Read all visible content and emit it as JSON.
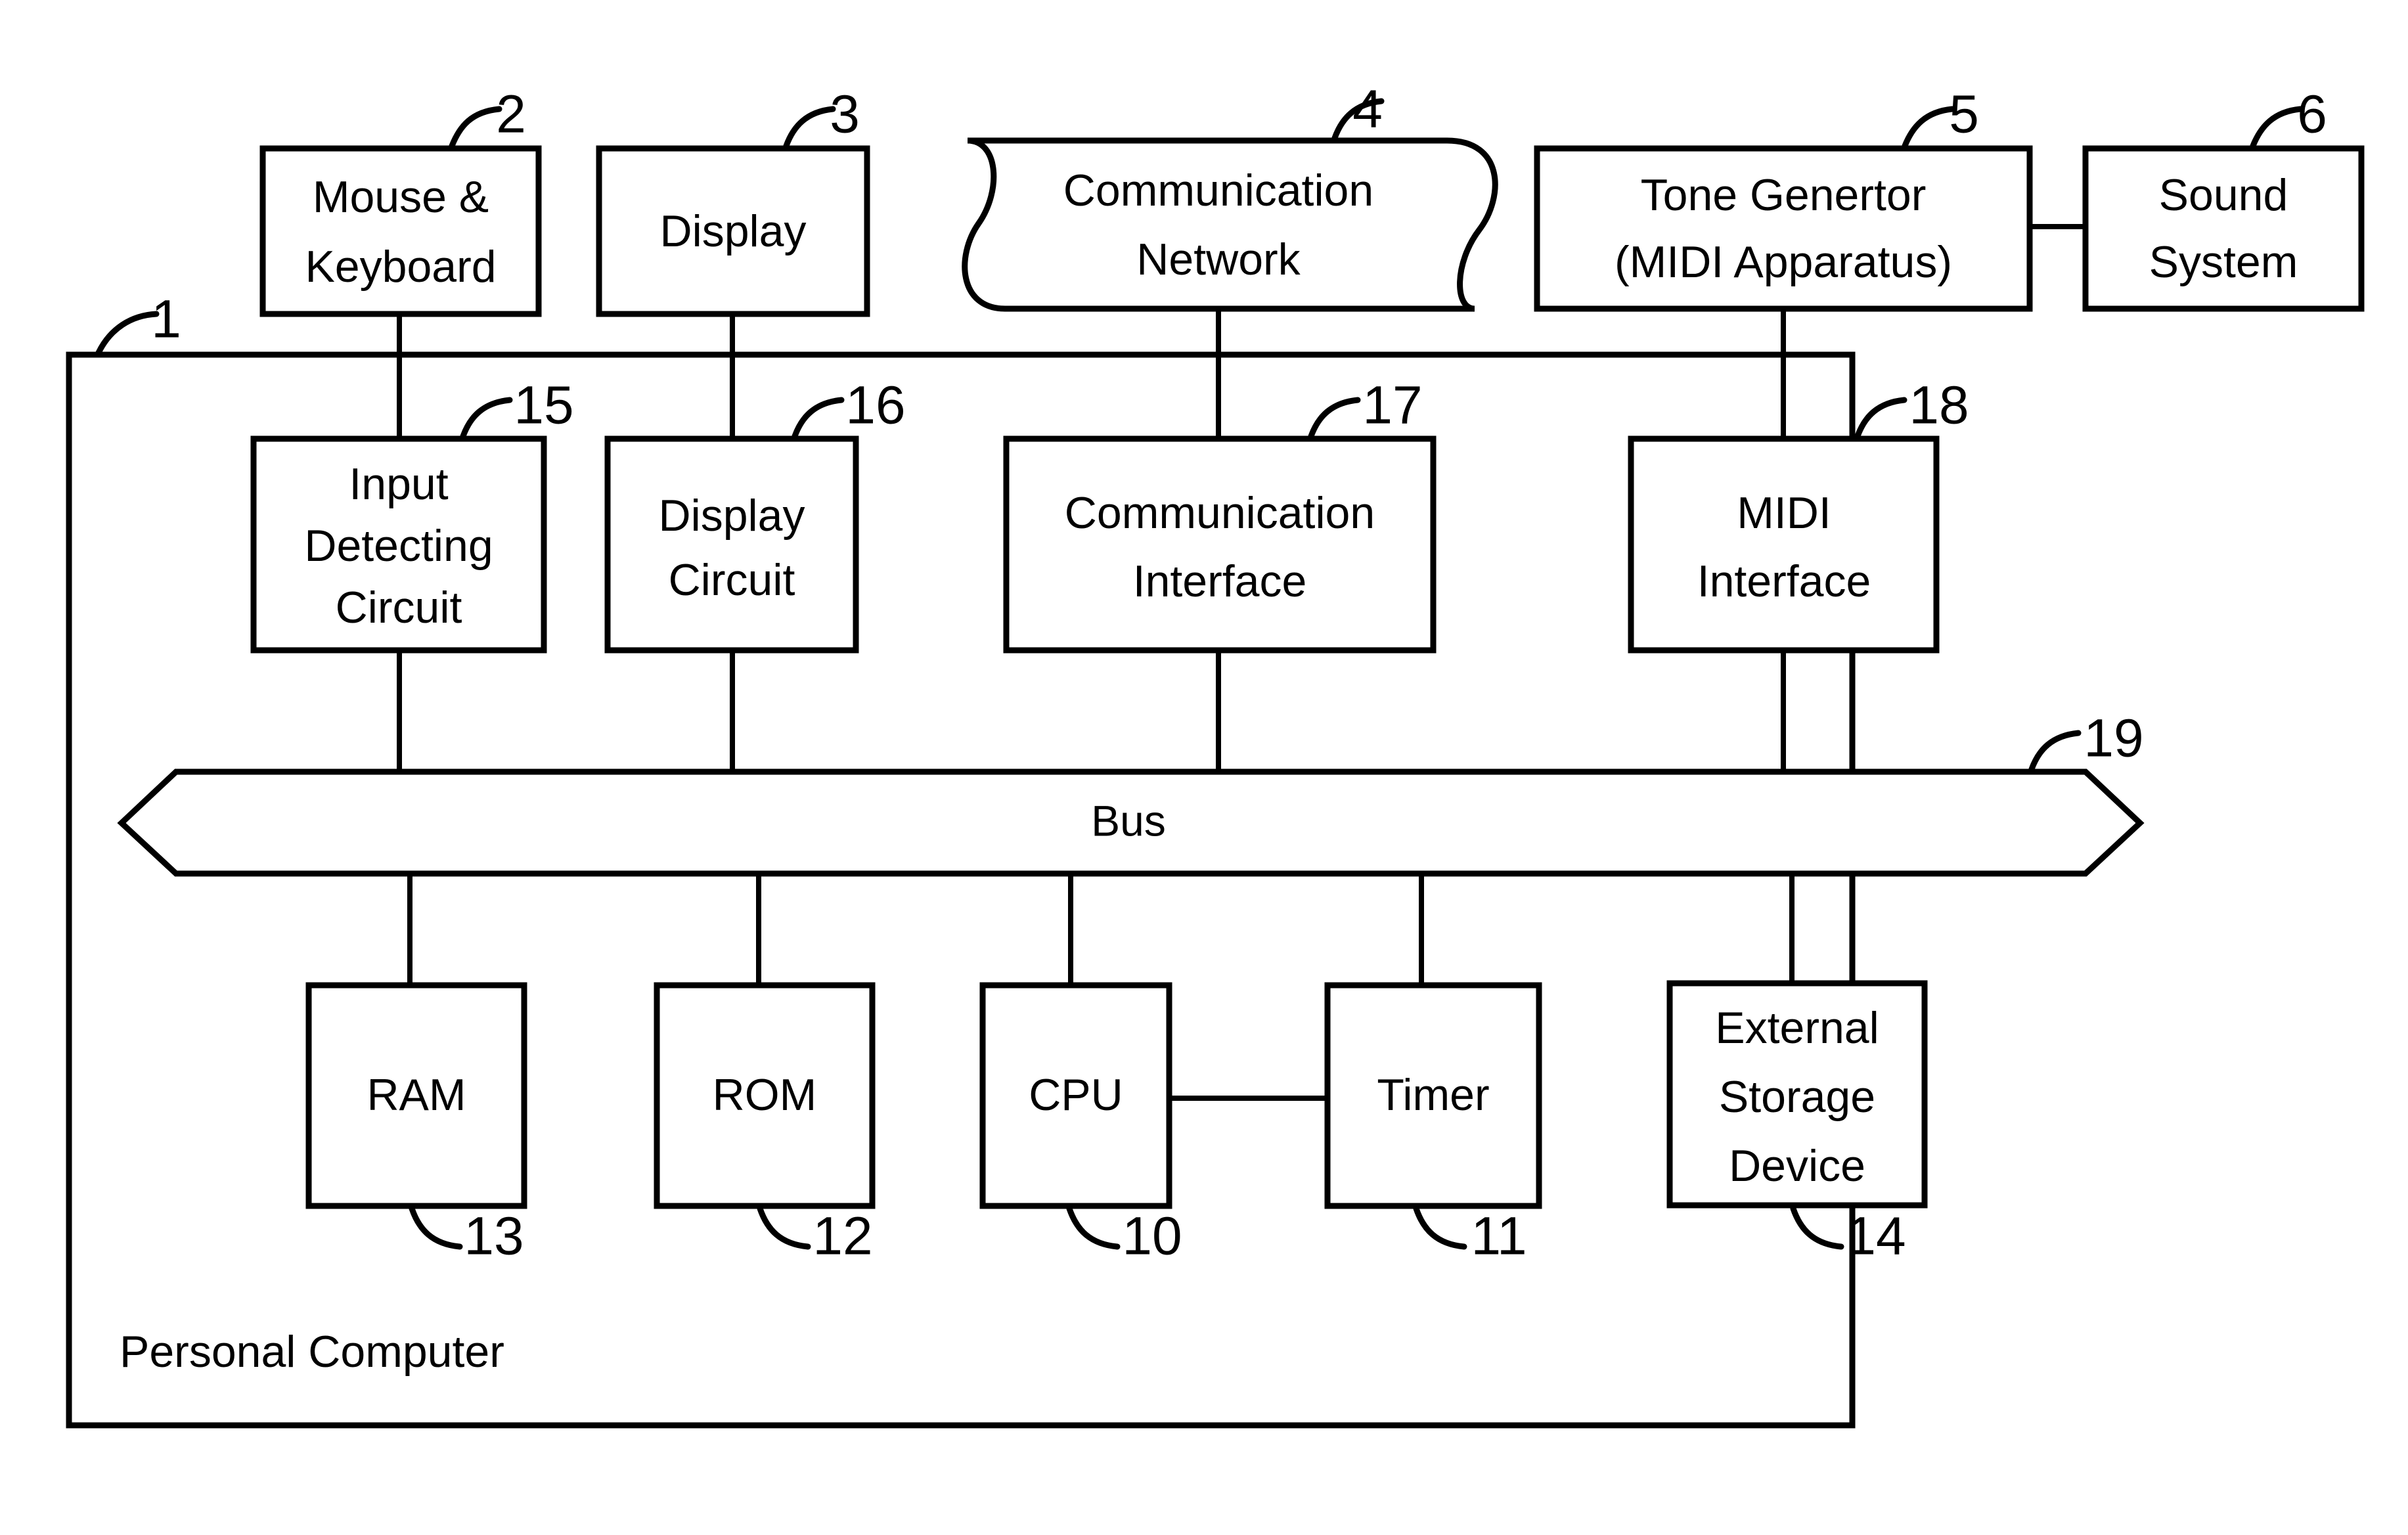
{
  "figure": {
    "enclosure": {
      "label": "Personal Computer",
      "ref": "1"
    },
    "external_devices": [
      {
        "id": "mouse-keyboard",
        "lines": [
          "Mouse &",
          "Keyboard"
        ],
        "ref": "2"
      },
      {
        "id": "display",
        "lines": [
          "Display"
        ],
        "ref": "3"
      },
      {
        "id": "communication-network",
        "lines": [
          "Communication",
          "Network"
        ],
        "ref": "4"
      },
      {
        "id": "tone-generator",
        "lines": [
          "Tone Genertor",
          "(MIDI Apparatus)"
        ],
        "ref": "5"
      },
      {
        "id": "sound-system",
        "lines": [
          "Sound",
          "System"
        ],
        "ref": "6"
      }
    ],
    "interface_circuits": [
      {
        "id": "input-detecting-circuit",
        "lines": [
          "Input",
          "Detecting",
          "Circuit"
        ],
        "ref": "15"
      },
      {
        "id": "display-circuit",
        "lines": [
          "Display",
          "Circuit"
        ],
        "ref": "16"
      },
      {
        "id": "communication-interface",
        "lines": [
          "Communication",
          "Interface"
        ],
        "ref": "17"
      },
      {
        "id": "midi-interface",
        "lines": [
          "MIDI",
          "Interface"
        ],
        "ref": "18"
      }
    ],
    "bus": {
      "label": "Bus",
      "ref": "19"
    },
    "core_components": [
      {
        "id": "ram",
        "lines": [
          "RAM"
        ],
        "ref": "13"
      },
      {
        "id": "rom",
        "lines": [
          "ROM"
        ],
        "ref": "12"
      },
      {
        "id": "cpu",
        "lines": [
          "CPU"
        ],
        "ref": "10"
      },
      {
        "id": "timer",
        "lines": [
          "Timer"
        ],
        "ref": "11"
      },
      {
        "id": "external-storage-device",
        "lines": [
          "External",
          "Storage",
          "Device"
        ],
        "ref": "14"
      }
    ],
    "colors": {
      "ink": "#000000",
      "paper": "#ffffff"
    }
  }
}
